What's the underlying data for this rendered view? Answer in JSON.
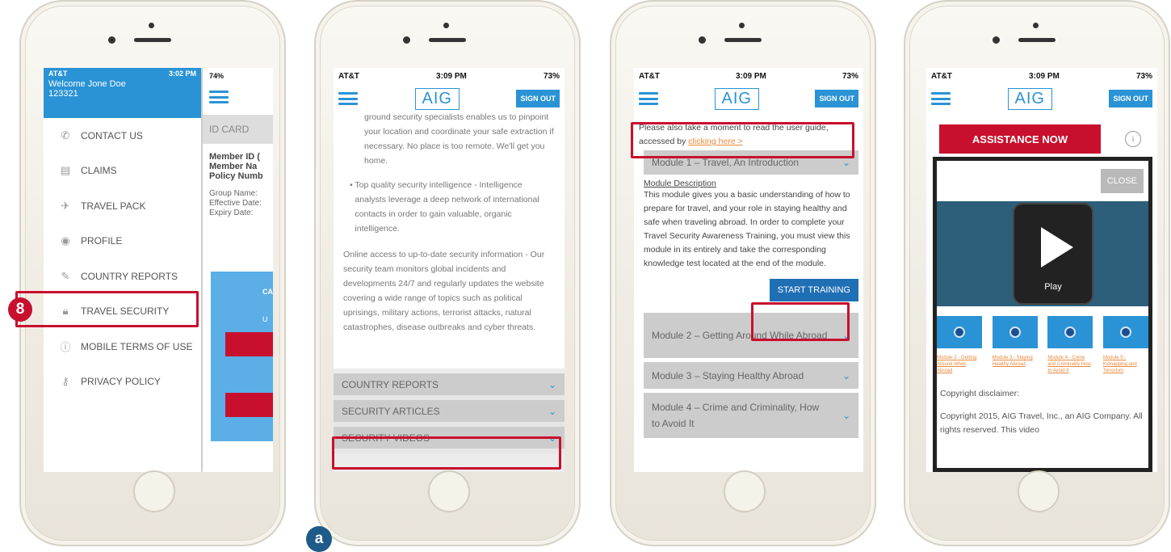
{
  "accent_color": "#2a93d5",
  "highlight_color": "#c8102e",
  "phone1": {
    "status": {
      "carrier": "AT&T",
      "time": "3:02 PM",
      "battery": "74%"
    },
    "welcome": "Welcome Jone Doe",
    "member_number": "123321",
    "menu_items": [
      {
        "label": "CONTACT US",
        "icon": "phone-icon"
      },
      {
        "label": "CLAIMS",
        "icon": "document-icon"
      },
      {
        "label": "TRAVEL PACK",
        "icon": "airplane-icon"
      },
      {
        "label": "PROFILE",
        "icon": "profile-icon"
      },
      {
        "label": "COUNTRY REPORTS",
        "icon": "pen-icon"
      },
      {
        "label": "TRAVEL SECURITY",
        "icon": "lock-icon"
      },
      {
        "label": "MOBILE TERMS OF USE",
        "icon": "info-icon"
      },
      {
        "label": "PRIVACY POLICY",
        "icon": "key-icon"
      }
    ],
    "id_card_title": "ID CARD",
    "card_lines_bold": [
      "Member ID (",
      "Member Na",
      "Policy Numb"
    ],
    "card_lines": [
      "Group Name:",
      "Effective Date:",
      "Expiry Date:"
    ],
    "card_blue_heading": "CA",
    "card_blue_sub": "U",
    "badge": "8"
  },
  "phone2": {
    "status": {
      "carrier": "AT&T",
      "time": "3:09 PM",
      "battery": "73%"
    },
    "logo": "AIG",
    "signout": "SIGN OUT",
    "para1": "ground security specialists enables us to pinpoint your location and coordinate your safe extraction if necessary. No place is too remote. We'll get you home.",
    "bullet": "Top quality security intelligence - Intelligence analysts leverage a deep network of international contacts in order to gain valuable, organic intelligence.",
    "para2": "Online access to up-to-date security information - Our security team monitors global incidents and developments 24/7 and regularly updates the website covering a wide range of topics such as political uprisings, military actions, terrorist attacks, natural catastrophes, disease outbreaks and cyber threats.",
    "sections": [
      "COUNTRY REPORTS",
      "SECURITY ARTICLES",
      "SECURITY VIDEOS"
    ],
    "badge": "a"
  },
  "phone3": {
    "status": {
      "carrier": "AT&T",
      "time": "3:09 PM",
      "battery": "73%"
    },
    "logo": "AIG",
    "signout": "SIGN OUT",
    "guide_text": "Please also take a moment to read the user guide, accessed by",
    "guide_link": "clicking here >",
    "module1": "Module 1 – Travel, An Introduction",
    "desc_title": "Module Description",
    "desc": "This module gives you a basic understanding of how to prepare for travel, and your role in staying healthy and safe when traveling abroad. In order to complete your Travel Security Awareness Training, you must view this module in its entirely and take the corresponding knowledge test located at the end of the module.",
    "start_button": "START TRAINING",
    "module2": "Module 2 – Getting Around While Abroad",
    "module3": "Module 3 – Staying Healthy Abroad",
    "module4": "Module 4 – Crime and Criminality, How to Avoid It"
  },
  "phone4": {
    "status": {
      "carrier": "AT&T",
      "time": "3:09 PM",
      "battery": "73%"
    },
    "logo": "AIG",
    "signout": "SIGN OUT",
    "assistance": "ASSISTANCE NOW",
    "info_icon": "i",
    "close": "CLOSE",
    "play": "Play",
    "video_links": [
      "Module 2 - Getting Around While Abroad",
      "Module 3 - Staying Healthy Abroad",
      "Module 4 - Crime and Criminality How to Avoid It",
      "Module 5 - Kidnapping and Terrorism"
    ],
    "copyright_title": "Copyright disclaimer:",
    "copyright_text": "Copyright 2015, AIG Travel, Inc., an AIG Company. All rights reserved. This video"
  }
}
